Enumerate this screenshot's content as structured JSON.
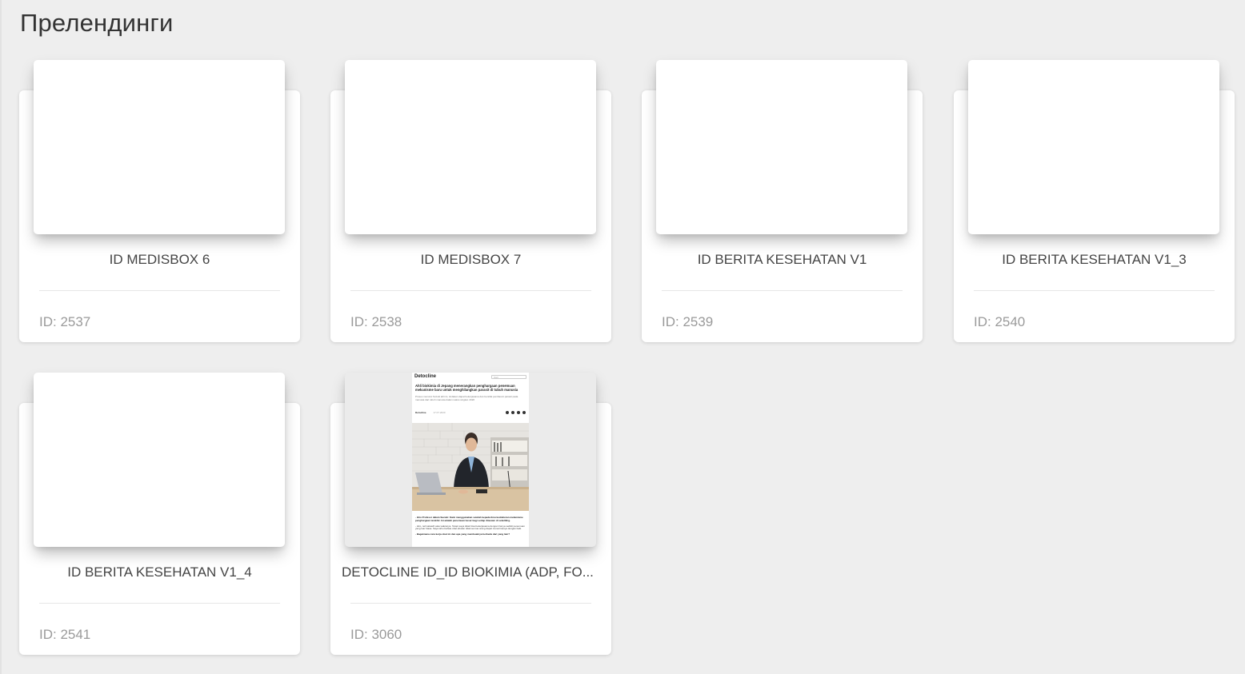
{
  "page": {
    "title": "Прелендинги"
  },
  "cards": [
    {
      "name": "ID MEDISBOX 6",
      "id_label": "ID: 2537"
    },
    {
      "name": "ID MEDISBOX 7",
      "id_label": "ID: 2538"
    },
    {
      "name": "ID BERITA KESEHATAN V1",
      "id_label": "ID: 2539"
    },
    {
      "name": "ID BERITA KESEHATAN V1_3",
      "id_label": "ID: 2540"
    },
    {
      "name": "ID BERITA KESEHATAN V1_4",
      "id_label": "ID: 2541"
    },
    {
      "name": "DETOCLINE ID_ID BIOKIMIA (ADP, FO...",
      "id_label": "ID: 3060"
    }
  ],
  "preview": {
    "brand": "Detocline",
    "search_placeholder": "Cari",
    "headline": "Ahli biokimia di Jepang menerangkan penghargaan penemuan mekanisme baru untuk menghilangkan parasit di tubuh manusia",
    "lead": "Proses menurut Suzuki ahli ini, tindakan dapat bekerjasama dan bersifat pembasmi parasit pada manusia dari tubuh manusia dalam waktu singkat. 2020",
    "author": "Detocline",
    "date": "17.07.2020",
    "body_bold": "- Hiro Profesor dalam Suzuki: Kami menggunakan setelah kepada ilmu kedokteran mekanisme penghargaan terakhir. Ini adalah penemuan besar bagi setiap ilmuwan di sekeliling.",
    "body_1": "- Hiro, terimakasih atas waktunya. Tetapi saya tidak bisa bekerjasama dengan hanya sedikit penemuan yang luar biasa. Saya tahu bahwa obat-obatan tidak semua orang dapat menerimanya dengan baik.",
    "body_2": "- Bagaimana cara kerja obat ini dan apa yang membuatnya berbeda dari yang lain?"
  }
}
